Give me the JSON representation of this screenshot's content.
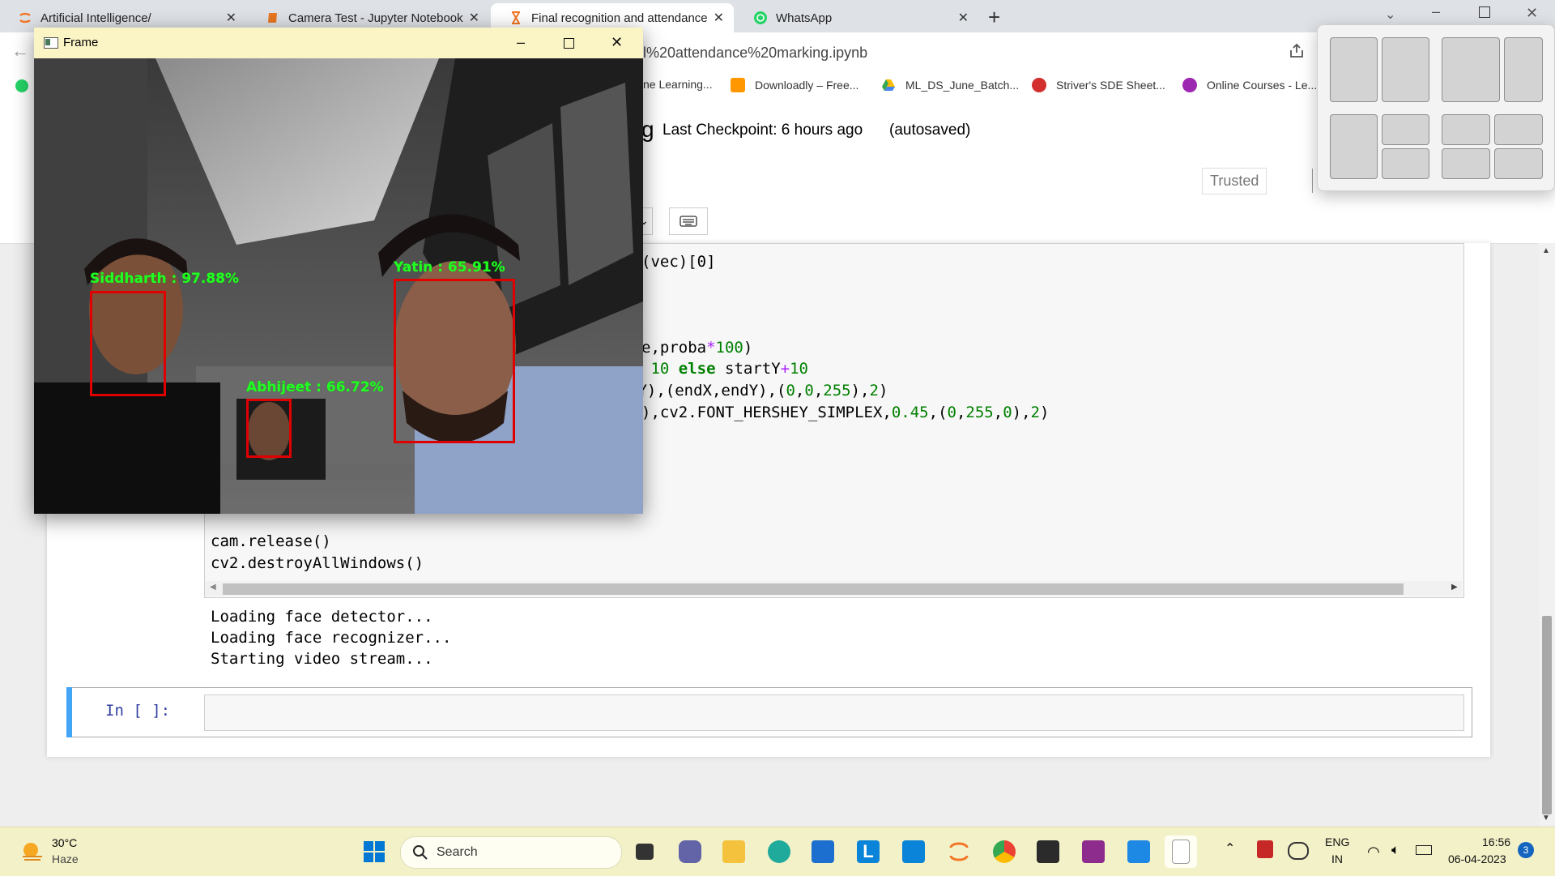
{
  "browser": {
    "tabs": [
      {
        "title": "Artificial Intelligence/",
        "icon": "jupyter-icon",
        "color": "#f37626"
      },
      {
        "title": "Camera Test - Jupyter Notebook",
        "icon": "notebook-icon",
        "color": "#e87722"
      },
      {
        "title": "Final recognition and attendance",
        "icon": "hourglass-icon",
        "color": "#f37626"
      },
      {
        "title": "WhatsApp",
        "icon": "whatsapp-icon",
        "color": "#25d366"
      }
    ],
    "url_fragment": "l%20attendance%20marking.ipynb",
    "bookmarks": [
      {
        "label": "ne Learning...",
        "color": "#2b6cb0"
      },
      {
        "label": "Downloadly – Free...",
        "color": "#ff9800"
      },
      {
        "label": "ML_DS_June_Batch...",
        "color": "#1a73e8"
      },
      {
        "label": "Striver's SDE Sheet...",
        "color": "#d32f2f"
      },
      {
        "label": "Online Courses - Le...",
        "color": "#9c27b0"
      }
    ]
  },
  "notebook": {
    "title_tail": "g",
    "checkpoint": "Last Checkpoint: 6 hours ago",
    "autosaved": "(autosaved)",
    "trusted": "Trusted",
    "code_line_1": "(vec)[0]",
    "code_line_2a": "e,proba",
    "code_line_2b": "*100)",
    "code_line_3": " 10 else startY+10",
    "code_line_4": "tY),(endX,endY),(0,0,255),2)",
    "code_line_5": "),cv2.FONT_HERSHEY_SIMPLEX,0.45,(0,255,0),2)",
    "code_release": "cam.release()",
    "code_destroy": "cv2.destroyAllWindows()",
    "output": [
      "Loading face detector...",
      "Loading face recognizer...",
      "Starting video stream..."
    ],
    "in_prompt": "In [ ]:"
  },
  "frame_window": {
    "title": "Frame",
    "faces": [
      {
        "label": "Siddharth : 97.88%"
      },
      {
        "label": "Abhijeet : 66.72%"
      },
      {
        "label": "Yatin : 65.91%"
      }
    ]
  },
  "taskbar": {
    "weather_temp": "30°C",
    "weather_desc": "Haze",
    "search_placeholder": "Search",
    "lang": "ENG",
    "region": "IN",
    "time": "16:56",
    "date": "06-04-2023",
    "notification_count": "3"
  },
  "colors": {
    "taskbar_bg": "#f3f1c8",
    "frame_title_bg": "#fbf5c6",
    "face_box": "#e00000",
    "face_label": "#22ff22",
    "cell_selected_bar": "#42a5f5"
  }
}
